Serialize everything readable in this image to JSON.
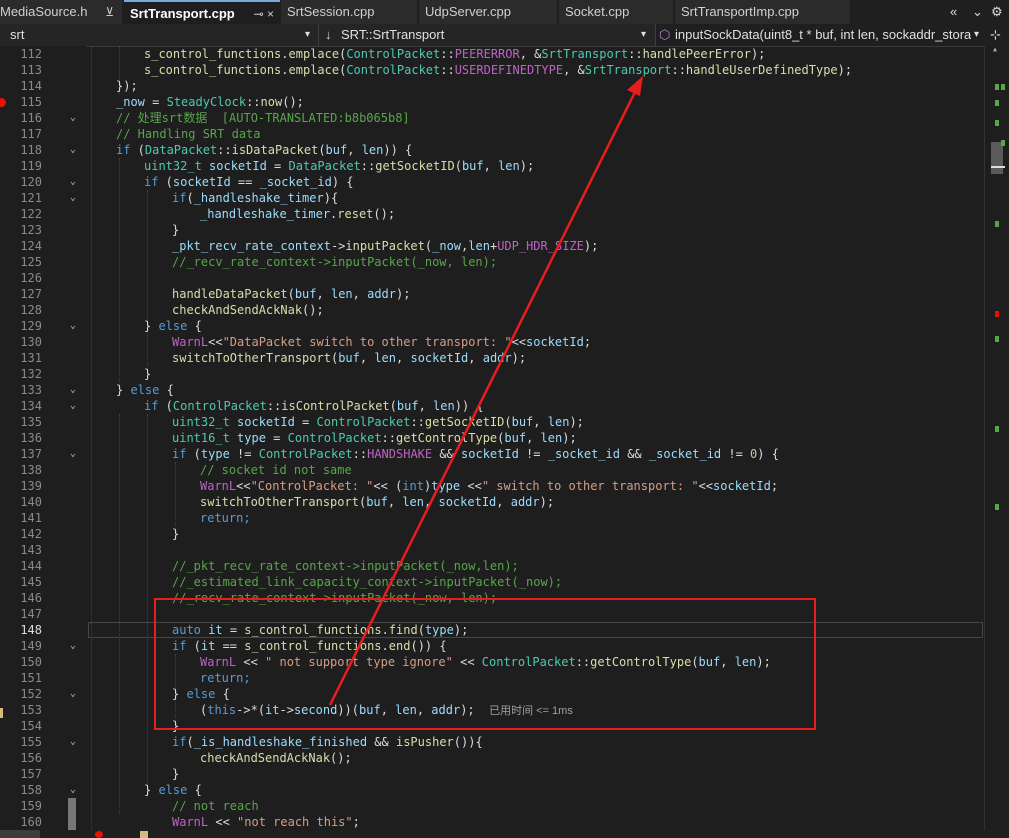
{
  "tabs": [
    {
      "label": "MediaSource.h",
      "icon": "pin-icon",
      "active": false
    },
    {
      "label": "SrtTransport.cpp",
      "icon": "pin-close-icon",
      "active": true
    },
    {
      "label": "SrtSession.cpp",
      "active": false
    },
    {
      "label": "UdpServer.cpp",
      "active": false
    },
    {
      "label": "Socket.cpp",
      "active": false
    },
    {
      "label": "SrtTransportImp.cpp",
      "active": false
    }
  ],
  "nav": {
    "project": "srt",
    "scope": "SRT::SrtTransport",
    "member": "inputSockData(uint8_t * buf, int len, sockaddr_stora"
  },
  "colors": {
    "highlight": "#e81d1d",
    "arrow": "#e81d1d"
  },
  "code": {
    "lines": [
      {
        "num": "112",
        "text": "s_control_functions.emplace(ControlPacket::PEERERROR, &SrtTransport::handlePeerError);"
      },
      {
        "num": "113",
        "text": "s_control_functions.emplace(ControlPacket::USERDEFINEDTYPE, &SrtTransport::handleUserDefinedType);"
      },
      {
        "num": "114",
        "text": "});"
      },
      {
        "num": "115",
        "text": "_now = SteadyClock::now();"
      },
      {
        "num": "116",
        "text": "// 处理srt数据  [AUTO-TRANSLATED:b8b065b8]"
      },
      {
        "num": "117",
        "text": "// Handling SRT data"
      },
      {
        "num": "118",
        "text": "if (DataPacket::isDataPacket(buf, len)) {"
      },
      {
        "num": "119",
        "text": "uint32_t socketId = DataPacket::getSocketID(buf, len);"
      },
      {
        "num": "120",
        "text": "if (socketId == _socket_id) {"
      },
      {
        "num": "121",
        "text": "if(_handleshake_timer){"
      },
      {
        "num": "122",
        "text": "_handleshake_timer.reset();"
      },
      {
        "num": "123",
        "text": "}"
      },
      {
        "num": "124",
        "text": "_pkt_recv_rate_context->inputPacket(_now,len+UDP_HDR_SIZE);"
      },
      {
        "num": "125",
        "text": "//_recv_rate_context->inputPacket(_now, len);"
      },
      {
        "num": "126",
        "text": ""
      },
      {
        "num": "127",
        "text": "handleDataPacket(buf, len, addr);"
      },
      {
        "num": "128",
        "text": "checkAndSendAckNak();"
      },
      {
        "num": "129",
        "text": "} else {"
      },
      {
        "num": "130",
        "text": "WarnL<<\"DataPacket switch to other transport: \"<<socketId;"
      },
      {
        "num": "131",
        "text": "switchToOtherTransport(buf, len, socketId, addr);"
      },
      {
        "num": "132",
        "text": "}"
      },
      {
        "num": "133",
        "text": "} else {"
      },
      {
        "num": "134",
        "text": "if (ControlPacket::isControlPacket(buf, len)) {"
      },
      {
        "num": "135",
        "text": "uint32_t socketId = ControlPacket::getSocketID(buf, len);"
      },
      {
        "num": "136",
        "text": "uint16_t type = ControlPacket::getControlType(buf, len);"
      },
      {
        "num": "137",
        "text": "if (type != ControlPacket::HANDSHAKE && socketId != _socket_id && _socket_id != 0) {"
      },
      {
        "num": "138",
        "text": "// socket id not same"
      },
      {
        "num": "139",
        "text": "WarnL<<\"ControlPacket: \"<< (int)type <<\" switch to other transport: \"<<socketId;"
      },
      {
        "num": "140",
        "text": "switchToOtherTransport(buf, len, socketId, addr);"
      },
      {
        "num": "141",
        "text": "return;"
      },
      {
        "num": "142",
        "text": "}"
      },
      {
        "num": "143",
        "text": ""
      },
      {
        "num": "144",
        "text": "//_pkt_recv_rate_context->inputPacket(_now,len);"
      },
      {
        "num": "145",
        "text": "//_estimated_link_capacity_context->inputPacket(_now);"
      },
      {
        "num": "146",
        "text": "//_recv_rate_context->inputPacket(_now, len);"
      },
      {
        "num": "147",
        "text": ""
      },
      {
        "num": "148",
        "text": "auto it = s_control_functions.find(type);"
      },
      {
        "num": "149",
        "text": "if (it == s_control_functions.end()) {"
      },
      {
        "num": "150",
        "text": "WarnL << \" not support type ignore\" << ControlPacket::getControlType(buf, len);"
      },
      {
        "num": "151",
        "text": "return;"
      },
      {
        "num": "152",
        "text": "} else {"
      },
      {
        "num": "153",
        "text": "(this->*(it->second))(buf, len, addr);"
      },
      {
        "num": "154",
        "text": "}"
      },
      {
        "num": "155",
        "text": "if(_is_handleshake_finished && isPusher()){"
      },
      {
        "num": "156",
        "text": "checkAndSendAckNak();"
      },
      {
        "num": "157",
        "text": "}"
      },
      {
        "num": "158",
        "text": "} else {"
      },
      {
        "num": "159",
        "text": "// not reach"
      },
      {
        "num": "160",
        "text": "WarnL << \"not reach this\";"
      }
    ],
    "perf_tip": "已用时间 <= 1ms"
  }
}
